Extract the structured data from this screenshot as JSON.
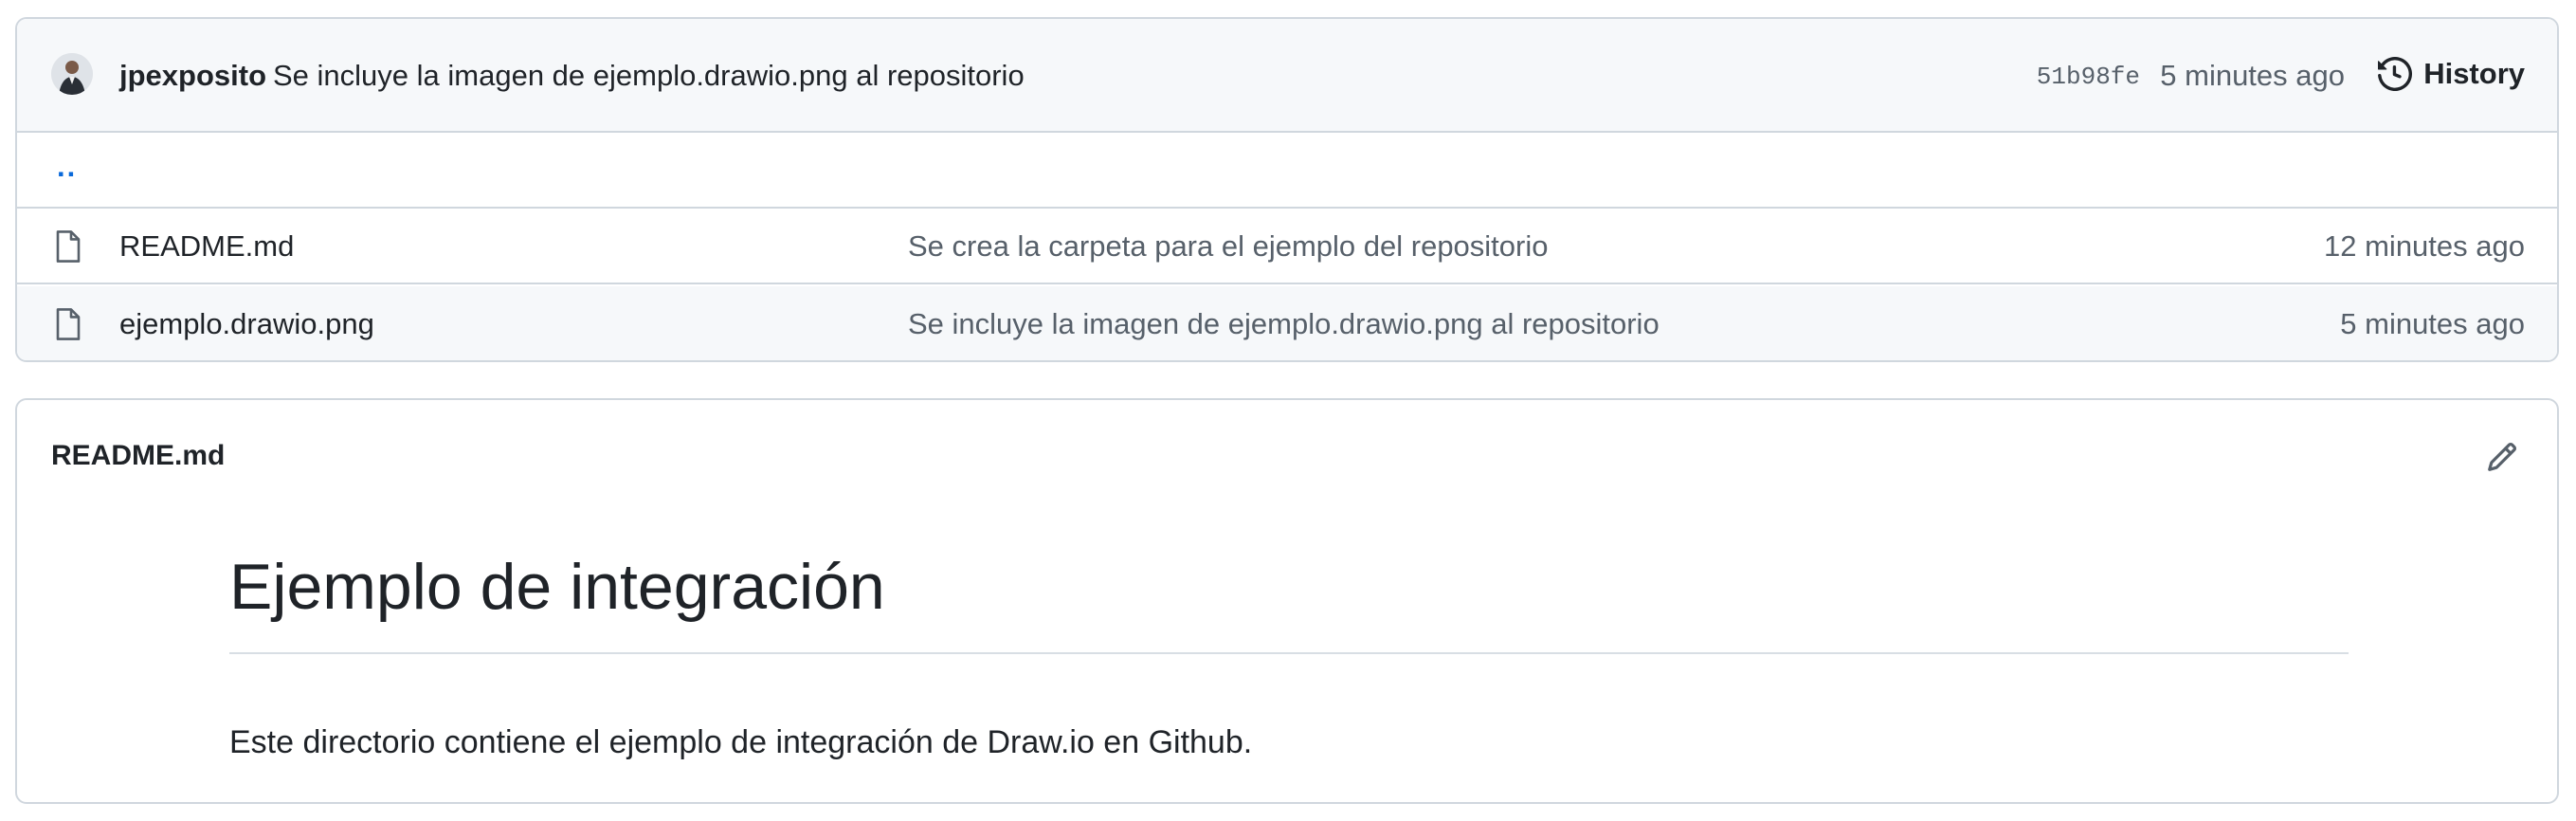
{
  "latest_commit": {
    "author": "jpexposito",
    "message": "Se incluye la imagen de ejemplo.drawio.png al repositorio",
    "sha": "51b98fe",
    "time": "5 minutes ago",
    "avatar_icon": "user-avatar"
  },
  "history": {
    "label": "History",
    "icon": "history-icon"
  },
  "parent_directory": {
    "label": ".."
  },
  "files": [
    {
      "name": "README.md",
      "commit_message": "Se crea la carpeta para el ejemplo del repositorio",
      "time": "12 minutes ago",
      "icon": "file-icon"
    },
    {
      "name": "ejemplo.drawio.png",
      "commit_message": "Se incluye la imagen de ejemplo.drawio.png al repositorio",
      "time": "5 minutes ago",
      "icon": "file-icon"
    }
  ],
  "readme": {
    "filename": "README.md",
    "edit_icon": "pencil-icon",
    "heading": "Ejemplo de integración",
    "paragraph": "Este directorio contiene el ejemplo de integración de Draw.io en Github."
  },
  "colors": {
    "border": "#d0d7de",
    "header_bg": "#f6f8fa",
    "text": "#1f2328",
    "muted_text": "#57606a",
    "link": "#0969da"
  }
}
